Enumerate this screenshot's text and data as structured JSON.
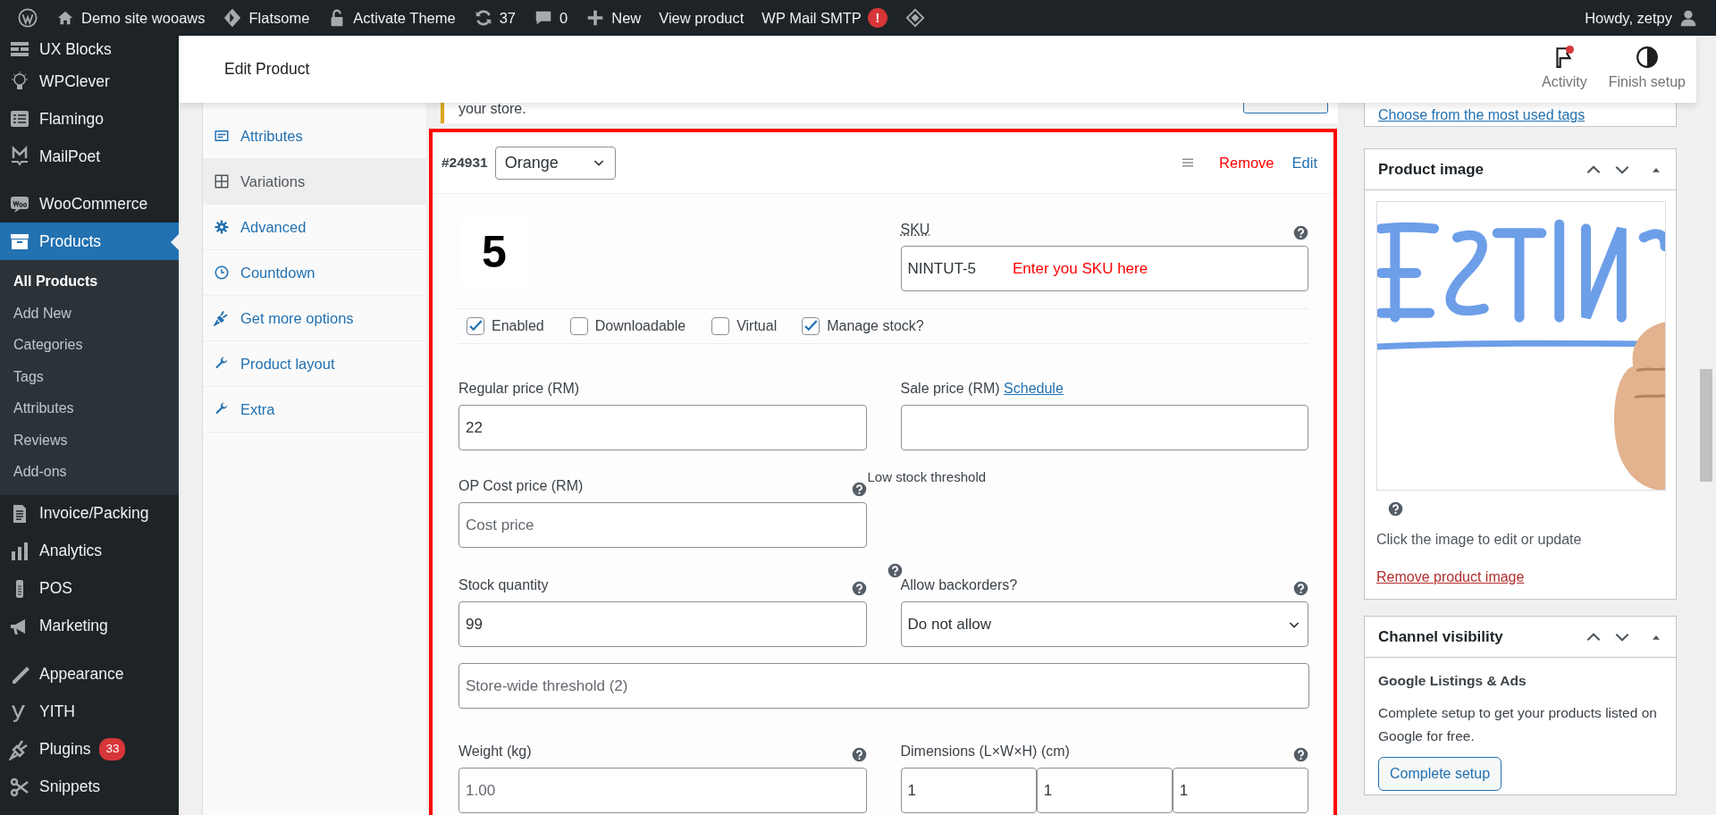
{
  "admin_bar": {
    "items": [
      {
        "kind": "wp-logo"
      },
      {
        "kind": "site",
        "label": "Demo site wooaws"
      },
      {
        "kind": "theme",
        "label": "Flatsome"
      },
      {
        "kind": "lock",
        "label": "Activate Theme"
      },
      {
        "kind": "updates",
        "label": "37"
      },
      {
        "kind": "comments",
        "label": "0"
      },
      {
        "kind": "new",
        "label": "New"
      },
      {
        "kind": "text",
        "label": "View product"
      },
      {
        "kind": "text",
        "label": "WP Mail SMTP",
        "badge": "!"
      },
      {
        "kind": "diamond"
      }
    ],
    "account": "Howdy, zetpy"
  },
  "sidebar": {
    "items": [
      {
        "label": "UX Blocks",
        "selected": false
      },
      {
        "label": "WPClever",
        "selected": false
      },
      {
        "label": "Flamingo",
        "selected": false
      },
      {
        "label": "MailPoet",
        "selected": false
      },
      {
        "label": "WooCommerce",
        "selected": false
      },
      {
        "label": "Products",
        "selected": true,
        "children": [
          {
            "label": "All Products",
            "selected": true
          },
          {
            "label": "Add New",
            "selected": false
          },
          {
            "label": "Categories",
            "selected": false
          },
          {
            "label": "Tags",
            "selected": false
          },
          {
            "label": "Attributes",
            "selected": false
          },
          {
            "label": "Reviews",
            "selected": false
          },
          {
            "label": "Add-ons",
            "selected": false
          }
        ]
      },
      {
        "label": "Invoice/Packing",
        "selected": false
      },
      {
        "label": "Analytics",
        "selected": false
      },
      {
        "label": "POS",
        "selected": false
      },
      {
        "label": "Marketing",
        "selected": false
      },
      {
        "label": "Appearance",
        "selected": false
      },
      {
        "label": "YITH",
        "selected": false
      },
      {
        "label": "Plugins",
        "selected": false,
        "badge": "33"
      },
      {
        "label": "Snippets",
        "selected": false
      }
    ]
  },
  "header": {
    "title": "Edit Product",
    "actions": [
      {
        "label": "Activity",
        "has_notification": true
      },
      {
        "label": "Finish setup",
        "has_notification": false
      }
    ]
  },
  "product_tabs": [
    {
      "label": "Attributes",
      "selected": false
    },
    {
      "label": "Variations",
      "selected": true
    },
    {
      "label": "Advanced",
      "selected": false
    },
    {
      "label": "Countdown",
      "selected": false
    },
    {
      "label": "Get more options",
      "selected": false
    },
    {
      "label": "Product layout",
      "selected": false
    },
    {
      "label": "Extra",
      "selected": false
    }
  ],
  "notice": {
    "text": "your store."
  },
  "variation": {
    "id": "#24931",
    "attribute": "Orange",
    "remove": "Remove",
    "edit": "Edit",
    "thumbnail": "5",
    "sku": {
      "label": "SKU",
      "value": "NINTUT-5",
      "annotation": "Enter you SKU here"
    },
    "options": [
      {
        "label": "Enabled",
        "checked": true
      },
      {
        "label": "Downloadable",
        "checked": false
      },
      {
        "label": "Virtual",
        "checked": false
      },
      {
        "label": "Manage stock?",
        "checked": true
      }
    ],
    "regular_price": {
      "label": "Regular price (RM)",
      "value": "22"
    },
    "sale_price": {
      "label": "Sale price (RM)",
      "link": "Schedule"
    },
    "cost_price": {
      "label": "OP Cost price (RM)",
      "placeholder": "Cost price"
    },
    "low_stock": {
      "label": "Low stock threshold",
      "placeholder": "Store-wide threshold (2)"
    },
    "stock_quantity": {
      "label": "Stock quantity",
      "value": "99"
    },
    "backorders": {
      "label": "Allow backorders?",
      "value": "Do not allow"
    },
    "weight": {
      "label": "Weight (kg)",
      "placeholder": "1.00"
    },
    "dimensions": {
      "label": "Dimensions (L×W×H) (cm)",
      "values": [
        "1",
        "1",
        "1"
      ]
    }
  },
  "tags_box": {
    "link": "Choose from the most used tags"
  },
  "product_image": {
    "title": "Product image",
    "hint": "Click the image to edit or update",
    "remove": "Remove product image"
  },
  "channel_visibility": {
    "title": "Channel visibility",
    "heading": "Google Listings & Ads",
    "text": "Complete setup to get your products listed on Google for free.",
    "button": "Complete setup"
  }
}
